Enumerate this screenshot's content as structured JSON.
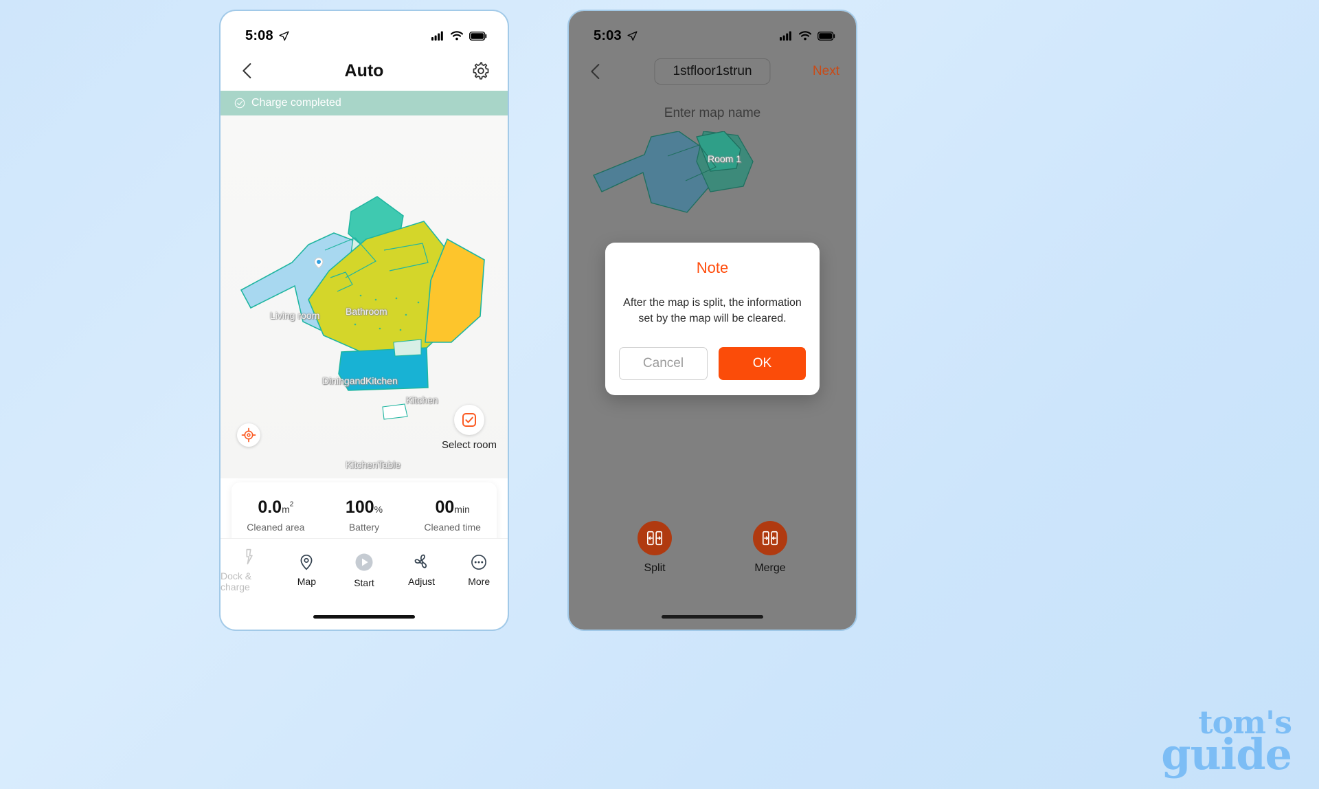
{
  "left_phone": {
    "status_bar": {
      "time": "5:08",
      "location_icon": "location-arrow-icon",
      "signal_icon": "cellular-signal-icon",
      "wifi_icon": "wifi-icon",
      "battery_icon": "battery-full-icon"
    },
    "nav": {
      "back_icon": "chevron-left-icon",
      "title": "Auto",
      "settings_icon": "gear-icon"
    },
    "banner": {
      "icon": "check-circle-icon",
      "text": "Charge completed",
      "color": "#a8d5c8"
    },
    "map": {
      "rooms": [
        {
          "name": "Living room",
          "color": "#a8d8f0"
        },
        {
          "name": "Bathroom",
          "color": "#3fc9b0"
        },
        {
          "name": "DiningandKitchen",
          "color": "#d4d62a"
        },
        {
          "name": "Kitchen",
          "color": "#fdc52c"
        },
        {
          "name": "KitchenTable",
          "color": "#18b2d4"
        }
      ],
      "locate_button_icon": "locate-target-icon",
      "select_room_icon": "checkbox-checked-icon",
      "select_room_label": "Select room",
      "robot_marker_icon": "robot-position-icon"
    },
    "stats": [
      {
        "value": "0.0",
        "unit": "m",
        "unit_sup": "2",
        "label": "Cleaned area"
      },
      {
        "value": "100",
        "unit": "%",
        "unit_sup": "",
        "label": "Battery"
      },
      {
        "value": "00",
        "unit": "min",
        "unit_sup": "",
        "label": "Cleaned time"
      }
    ],
    "tabbar": [
      {
        "label": "Dock & charge",
        "icon": "lightning-bolt-icon",
        "disabled": true
      },
      {
        "label": "Map",
        "icon": "map-pin-icon",
        "disabled": false
      },
      {
        "label": "Start",
        "icon": "play-circle-icon",
        "disabled": false
      },
      {
        "label": "Adjust",
        "icon": "fan-icon",
        "disabled": false
      },
      {
        "label": "More",
        "icon": "more-dots-icon",
        "disabled": false
      }
    ]
  },
  "right_phone": {
    "status_bar": {
      "time": "5:03",
      "location_icon": "location-arrow-icon",
      "signal_icon": "cellular-signal-icon",
      "wifi_icon": "wifi-icon",
      "battery_icon": "battery-full-icon"
    },
    "nav": {
      "back_icon": "chevron-left-icon",
      "map_name_value": "1stfloor1strun",
      "next_label": "Next"
    },
    "subtitle": "Enter map name",
    "map": {
      "rooms": [
        {
          "name": "Room 1",
          "color": "#4f7f96"
        }
      ]
    },
    "dialog": {
      "title": "Note",
      "message": "After the map is split, the information set by the map will be cleared.",
      "cancel_label": "Cancel",
      "ok_label": "OK",
      "ok_color": "#fb4c09",
      "title_color": "#ff4d0d"
    },
    "actions": [
      {
        "label": "Split",
        "icon": "split-map-icon",
        "color": "#b03a10"
      },
      {
        "label": "Merge",
        "icon": "merge-map-icon",
        "color": "#b03a10"
      }
    ]
  },
  "watermark": {
    "line1": "tom's",
    "line2": "guide",
    "color": "#7cbdf5"
  }
}
